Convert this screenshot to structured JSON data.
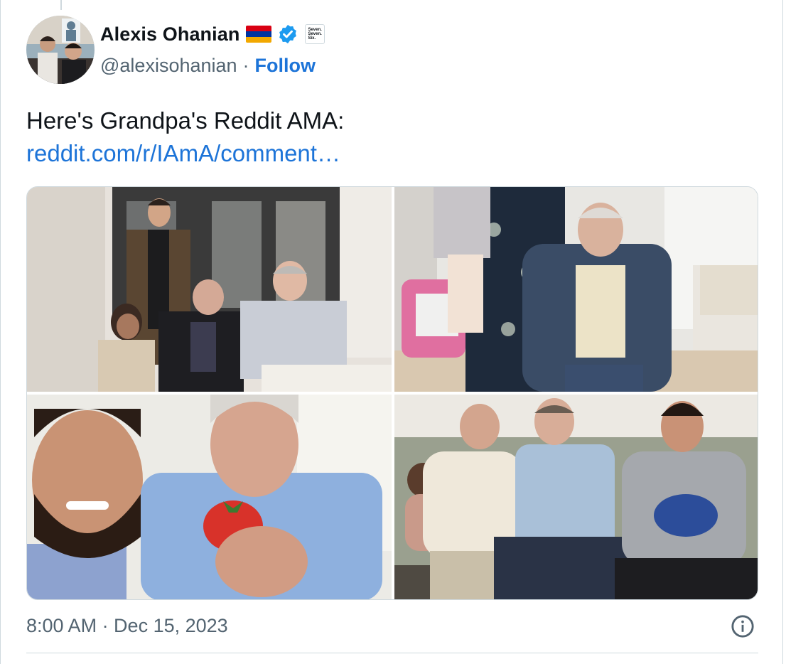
{
  "author": {
    "name": "Alexis Ohanian",
    "handle": "@alexisohanian",
    "follow_label": "Follow",
    "separator": "·",
    "flag_icon": "armenia-flag-icon",
    "verified_icon": "verified-badge-icon",
    "affiliate_badge": [
      "Seven.",
      "Seven.",
      "Six."
    ]
  },
  "tweet": {
    "text": "Here's Grandpa's Reddit AMA:",
    "link_text": "reddit.com/r/IAmA/comment…"
  },
  "media": {
    "photos": [
      {
        "icon": "photo-restaurant-family"
      },
      {
        "icon": "photo-grandpa-seated-with-child"
      },
      {
        "icon": "photo-selfie-with-tomato"
      },
      {
        "icon": "photo-couch-family"
      }
    ]
  },
  "footer": {
    "timestamp": "8:00 AM · Dec 15, 2023",
    "info_icon": "info-icon"
  },
  "colors": {
    "link": "#1d74d8",
    "secondary_text": "#536471",
    "verified": "#1d9bf0",
    "flag": [
      "#d90012",
      "#0033a0",
      "#f2a800"
    ]
  }
}
